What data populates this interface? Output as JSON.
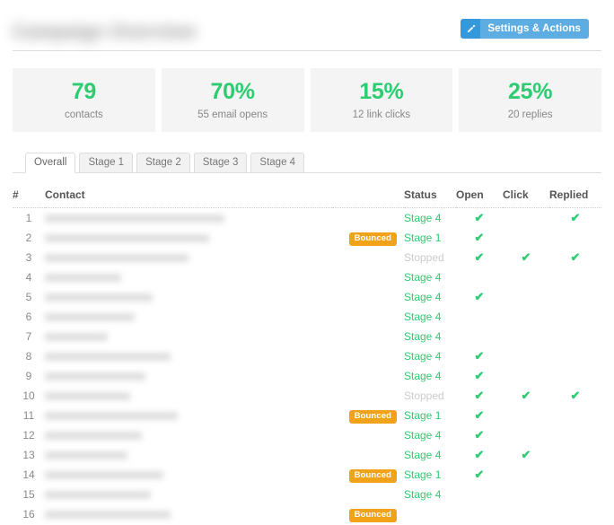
{
  "header": {
    "title": "Campaign Overview",
    "title_redacted": true,
    "settings_button": {
      "label": "Settings & Actions",
      "icon": "pencil-icon",
      "icon_bg": "#3498db",
      "label_bg": "#5dade2"
    }
  },
  "stats": [
    {
      "value": "79",
      "label": "contacts"
    },
    {
      "value": "70%",
      "label": "55 email opens"
    },
    {
      "value": "15%",
      "label": "12 link clicks"
    },
    {
      "value": "25%",
      "label": "20 replies"
    }
  ],
  "tabs": [
    {
      "label": "Overall",
      "active": true
    },
    {
      "label": "Stage 1",
      "active": false
    },
    {
      "label": "Stage 2",
      "active": false
    },
    {
      "label": "Stage 3",
      "active": false
    },
    {
      "label": "Stage 4",
      "active": false
    }
  ],
  "table": {
    "columns": [
      "#",
      "Contact",
      "",
      "Status",
      "Open",
      "Click",
      "Replied"
    ],
    "headers": {
      "num": "#",
      "contact": "Contact",
      "status": "Status",
      "open": "Open",
      "click": "Click",
      "replied": "Replied"
    },
    "check_glyph": "✔",
    "badge_label": "Bounced",
    "rows": [
      {
        "num": "1",
        "name_width": 200,
        "badge": null,
        "status": "Stage 4",
        "status_type": "stage",
        "open": true,
        "click": false,
        "replied": true
      },
      {
        "num": "2",
        "name_width": 183,
        "badge": "Bounced",
        "status": "Stage 1",
        "status_type": "stage",
        "open": true,
        "click": false,
        "replied": false
      },
      {
        "num": "3",
        "name_width": 160,
        "badge": null,
        "status": "Stopped",
        "status_type": "stopped",
        "open": true,
        "click": true,
        "replied": true
      },
      {
        "num": "4",
        "name_width": 85,
        "badge": null,
        "status": "Stage 4",
        "status_type": "stage",
        "open": false,
        "click": false,
        "replied": false
      },
      {
        "num": "5",
        "name_width": 120,
        "badge": null,
        "status": "Stage 4",
        "status_type": "stage",
        "open": true,
        "click": false,
        "replied": false
      },
      {
        "num": "6",
        "name_width": 100,
        "badge": null,
        "status": "Stage 4",
        "status_type": "stage",
        "open": false,
        "click": false,
        "replied": false
      },
      {
        "num": "7",
        "name_width": 70,
        "badge": null,
        "status": "Stage 4",
        "status_type": "stage",
        "open": false,
        "click": false,
        "replied": false
      },
      {
        "num": "8",
        "name_width": 140,
        "badge": null,
        "status": "Stage 4",
        "status_type": "stage",
        "open": true,
        "click": false,
        "replied": false
      },
      {
        "num": "9",
        "name_width": 112,
        "badge": null,
        "status": "Stage 4",
        "status_type": "stage",
        "open": true,
        "click": false,
        "replied": false
      },
      {
        "num": "10",
        "name_width": 95,
        "badge": null,
        "status": "Stopped",
        "status_type": "stopped",
        "open": true,
        "click": true,
        "replied": true
      },
      {
        "num": "11",
        "name_width": 148,
        "badge": "Bounced",
        "status": "Stage 1",
        "status_type": "stage",
        "open": true,
        "click": false,
        "replied": false
      },
      {
        "num": "12",
        "name_width": 108,
        "badge": null,
        "status": "Stage 4",
        "status_type": "stage",
        "open": true,
        "click": false,
        "replied": false
      },
      {
        "num": "13",
        "name_width": 92,
        "badge": null,
        "status": "Stage 4",
        "status_type": "stage",
        "open": true,
        "click": true,
        "replied": false
      },
      {
        "num": "14",
        "name_width": 132,
        "badge": "Bounced",
        "status": "Stage 1",
        "status_type": "stage",
        "open": true,
        "click": false,
        "replied": false
      },
      {
        "num": "15",
        "name_width": 118,
        "badge": null,
        "status": "Stage 4",
        "status_type": "stage",
        "open": false,
        "click": false,
        "replied": false
      },
      {
        "num": "16",
        "name_width": 140,
        "badge": "Bounced",
        "status": "",
        "status_type": "stage",
        "open": false,
        "click": false,
        "replied": false
      }
    ]
  },
  "colors": {
    "green": "#2ecc71",
    "orange": "#f0a318",
    "blue_dark": "#3498db",
    "blue_light": "#5dade2",
    "grey_card": "#f4f4f4",
    "grey_muted": "#cccccc"
  }
}
